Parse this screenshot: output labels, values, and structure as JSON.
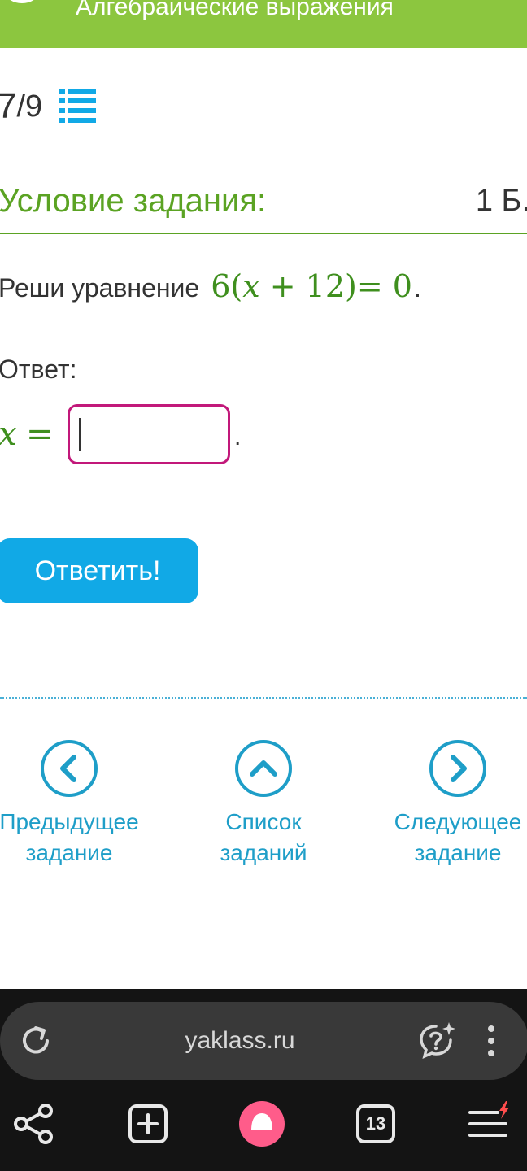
{
  "header": {
    "title": "Алгебраические выражения",
    "bg_color": "#8cc63f",
    "icon": "check-circle-icon"
  },
  "progress": {
    "current": "7",
    "total": "/9",
    "list_icon": "task-list-icon"
  },
  "task": {
    "condition_label": "Условие задания:",
    "points": "1 Б."
  },
  "problem": {
    "prompt": "Реши уравнение",
    "equation": {
      "coef": "6",
      "open": "(",
      "var": "x",
      "plus": " + ",
      "const": "12",
      "close": ")",
      "equals": "= ",
      "rhs": "0"
    },
    "period": "."
  },
  "answer": {
    "label": "Ответ:",
    "var": "x",
    "eq": "=",
    "input_value": "",
    "trailing": ".",
    "input_border_color": "#c2187a"
  },
  "submit": {
    "label": "Ответить!",
    "color": "#11a9e6"
  },
  "nav": {
    "prev": {
      "line1": "Предыдущее",
      "line2": "задание",
      "icon": "chevron-left-circle-icon"
    },
    "list": {
      "line1": "Список",
      "line2": "заданий",
      "icon": "chevron-up-circle-icon"
    },
    "next": {
      "line1": "Следующее",
      "line2": "задание",
      "icon": "chevron-right-circle-icon"
    },
    "color": "#1e9ec8"
  },
  "browser": {
    "url": "yaklass.ru",
    "tabs_count": "13",
    "icons": {
      "reload": "reload-icon",
      "assistant": "assistant-icon",
      "more": "more-vertical-icon",
      "share": "share-icon",
      "new_tab": "new-tab-icon",
      "home": "alice-home-icon",
      "tabs": "tabs-icon",
      "menu": "menu-icon"
    },
    "accent_color": "#ff5c8a"
  }
}
